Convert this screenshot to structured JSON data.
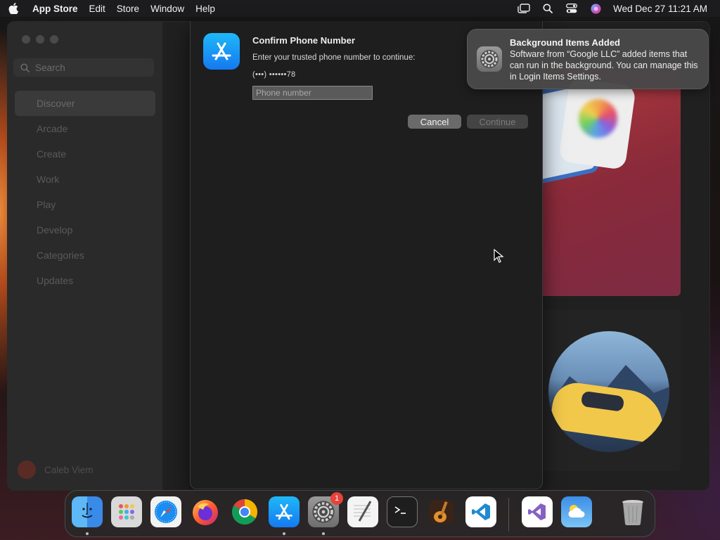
{
  "menubar": {
    "app_name": "App Store",
    "menus": [
      "Edit",
      "Store",
      "Window",
      "Help"
    ],
    "clock": "Wed Dec 27  11:21 AM"
  },
  "background_window": {
    "search_placeholder": "Search",
    "nav_items": [
      "Discover",
      "Arcade",
      "Create",
      "Work",
      "Play",
      "Develop",
      "Categories",
      "Updates"
    ],
    "active_nav": "Discover",
    "user_name": "Caleb Viem"
  },
  "dialog": {
    "title": "Confirm Phone Number",
    "subtitle": "Enter your trusted phone number to continue:",
    "masked_number": "(•••) ••••••78",
    "input_placeholder": "Phone number",
    "input_value": "",
    "cancel_label": "Cancel",
    "continue_label": "Continue"
  },
  "notification": {
    "title": "Background Items Added",
    "body": "Software from “Google LLC” added items that can run in the background. You can manage this in Login Items Settings."
  },
  "dock": {
    "items": [
      {
        "name": "Finder",
        "icon": "finder-icon",
        "running": true
      },
      {
        "name": "Launchpad",
        "icon": "launchpad-icon",
        "running": false
      },
      {
        "name": "Safari",
        "icon": "safari-icon",
        "running": false
      },
      {
        "name": "Firefox",
        "icon": "firefox-icon",
        "running": false
      },
      {
        "name": "Chrome",
        "icon": "chrome-icon",
        "running": false
      },
      {
        "name": "App Store",
        "icon": "app-store-icon",
        "running": true
      },
      {
        "name": "System Settings",
        "icon": "system-settings-icon",
        "running": true,
        "badge": "1"
      },
      {
        "name": "TextEdit",
        "icon": "textedit-icon",
        "running": false
      },
      {
        "name": "Terminal",
        "icon": "terminal-icon",
        "running": false
      },
      {
        "name": "GarageBand",
        "icon": "garageband-icon",
        "running": false
      },
      {
        "name": "Visual Studio Code",
        "icon": "vscode-icon",
        "running": false
      },
      {
        "name": "Visual Studio",
        "icon": "visual-studio-icon",
        "running": false
      },
      {
        "name": "Weather",
        "icon": "weather-icon",
        "running": false
      },
      {
        "name": "Trash",
        "icon": "trash-icon",
        "running": false
      }
    ]
  }
}
